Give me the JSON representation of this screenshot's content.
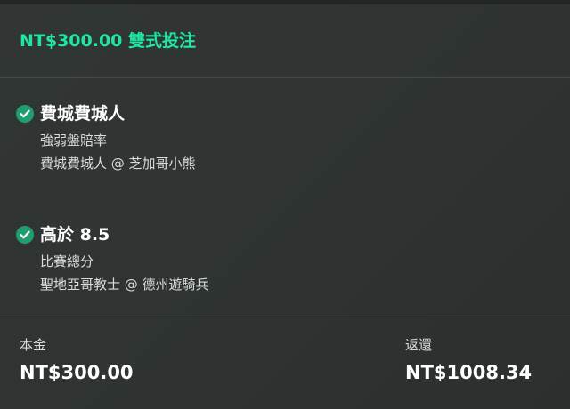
{
  "colors": {
    "accent": "#1fe6a2",
    "check": "#1f9e70"
  },
  "header": {
    "stake": "NT$300.00",
    "bet_type": "雙式投注"
  },
  "legs": [
    {
      "icon": "check-circle-icon",
      "selection": "費城費城人",
      "market": "強弱盤賠率",
      "event": "費城費城人 @ 芝加哥小熊"
    },
    {
      "icon": "check-circle-icon",
      "selection": "高於 8.5",
      "market": "比賽總分",
      "event": "聖地亞哥教士 @ 德州遊騎兵"
    }
  ],
  "summary": {
    "stake_label": "本金",
    "stake_value": "NT$300.00",
    "return_label": "返還",
    "return_value": "NT$1008.34"
  }
}
